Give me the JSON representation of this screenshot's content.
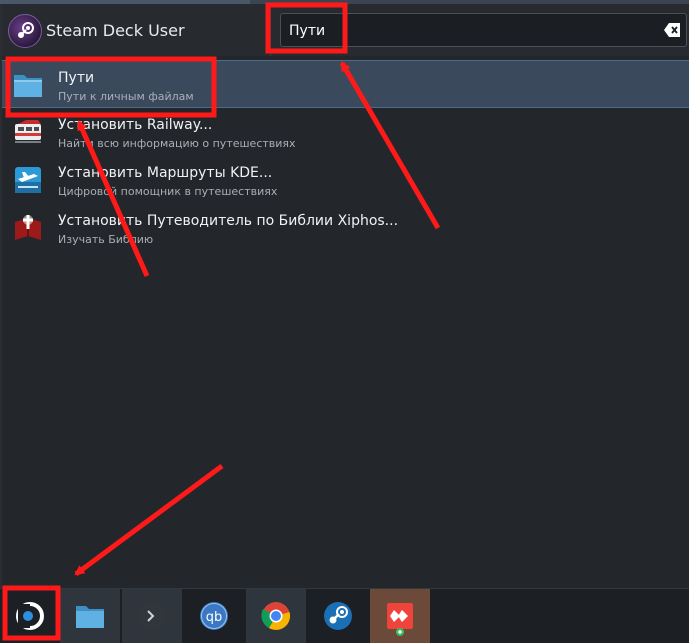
{
  "launcher": {
    "username": "Steam Deck User",
    "search_value": "Пути"
  },
  "results": [
    {
      "title": "Пути",
      "subtitle": "Пути к личным файлам",
      "icon": "folder-icon"
    },
    {
      "title": "Установить Railway...",
      "subtitle": "Найти всю информацию о путешествиях",
      "icon": "railway-icon"
    },
    {
      "title": "Установить Маршруты KDE...",
      "subtitle": "Цифровой помощник в путешествиях",
      "icon": "itinerary-icon"
    },
    {
      "title": "Установить Путеводитель по Библии Xiphos...",
      "subtitle": "Изучать Библию",
      "icon": "bible-icon"
    }
  ],
  "taskbar": {
    "items": [
      "app-launcher-icon",
      "file-manager-icon",
      "terminal-icon",
      "qbittorrent-icon",
      "chrome-icon",
      "steam-icon",
      "anydesk-icon"
    ],
    "qb_label": "qb"
  },
  "colors": {
    "accent": "#3a4a5c",
    "annotation": "#ff1a1a"
  }
}
